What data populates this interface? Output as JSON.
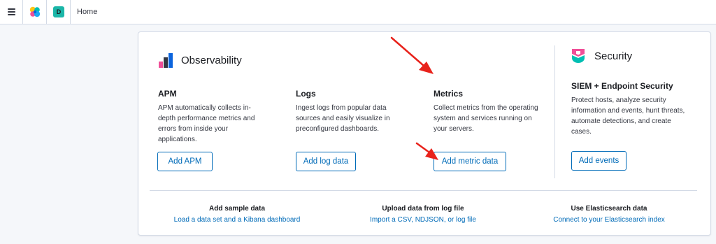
{
  "header": {
    "menu_icon": "hamburger-icon",
    "logo_icon": "kibana-logo-icon",
    "space_initial": "D",
    "breadcrumb": "Home"
  },
  "observability": {
    "title": "Observability",
    "icon": "observability-icon",
    "cards": [
      {
        "title": "APM",
        "desc_lines": [
          "APM automatically collects in-",
          "depth performance metrics and",
          "errors from inside your",
          "applications."
        ],
        "button": "Add APM"
      },
      {
        "title": "Logs",
        "desc_lines": [
          "Ingest logs from popular data",
          "sources and easily visualize in",
          "preconfigured dashboards."
        ],
        "button": "Add log data"
      },
      {
        "title": "Metrics",
        "desc_lines": [
          "Collect metrics from the operating",
          "system and services running on",
          "your servers."
        ],
        "button": "Add metric data"
      }
    ]
  },
  "security": {
    "title": "Security",
    "icon": "security-icon",
    "card_title": "SIEM + Endpoint Security",
    "desc_lines": [
      "Protect hosts, analyze security",
      "information and events, hunt threats,",
      "automate detections, and create",
      "cases."
    ],
    "button": "Add events"
  },
  "footer": [
    {
      "title": "Add sample data",
      "link": "Load a data set and a Kibana dashboard"
    },
    {
      "title": "Upload data from log file",
      "link": "Import a CSV, NDJSON, or log file"
    },
    {
      "title": "Use Elasticsearch data",
      "link": "Connect to your Elasticsearch index"
    }
  ],
  "colors": {
    "accent": "#006bb8",
    "annotation_arrow": "#e8221b"
  }
}
